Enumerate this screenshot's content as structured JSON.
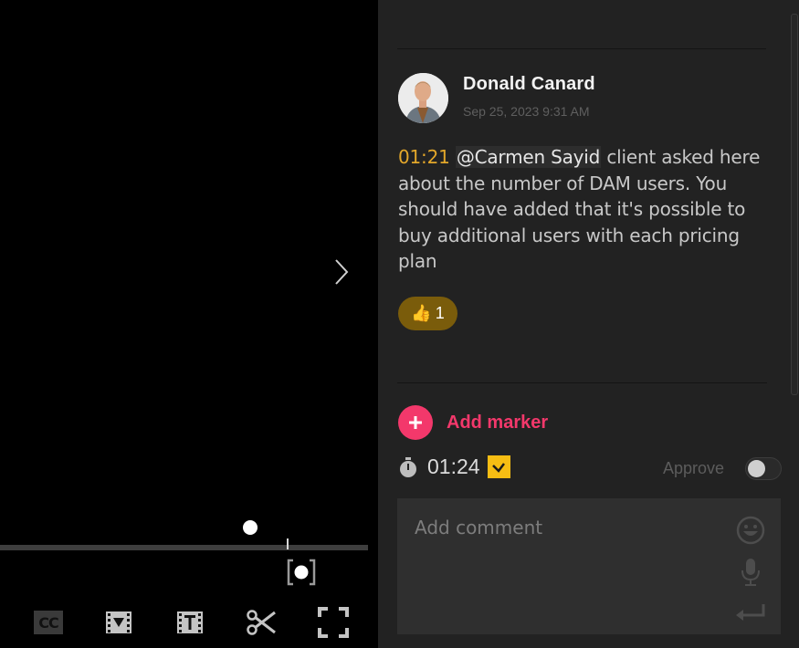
{
  "video": {
    "next_icon": "chevron-right-icon",
    "controls": [
      {
        "name": "closed-captions-button",
        "icon": "cc-icon",
        "label": "CC"
      },
      {
        "name": "video-marker-button",
        "icon": "film-marker-icon"
      },
      {
        "name": "video-text-button",
        "icon": "film-text-icon"
      },
      {
        "name": "trim-button",
        "icon": "scissors-icon"
      },
      {
        "name": "fullscreen-button",
        "icon": "fullscreen-icon"
      }
    ]
  },
  "comment": {
    "author": "Donald Canard",
    "timestamp": "Sep 25, 2023 9:31 AM",
    "time_marker": "01:21",
    "mention": "@Carmen Sayid",
    "body": " client asked here about the number of DAM users. You should have added that it's possible to buy additional users with each pricing plan",
    "reactions": [
      {
        "emoji": "👍",
        "count": "1"
      }
    ]
  },
  "composer": {
    "add_marker_label": "Add marker",
    "current_time": "01:24",
    "time_attached": true,
    "approve_label": "Approve",
    "approve_on": false,
    "placeholder": "Add comment"
  },
  "colors": {
    "accent": "#f3386b",
    "time_highlight": "#e3a72a",
    "check": "#f6bd13",
    "reaction_bg": "#7a5c0b"
  }
}
